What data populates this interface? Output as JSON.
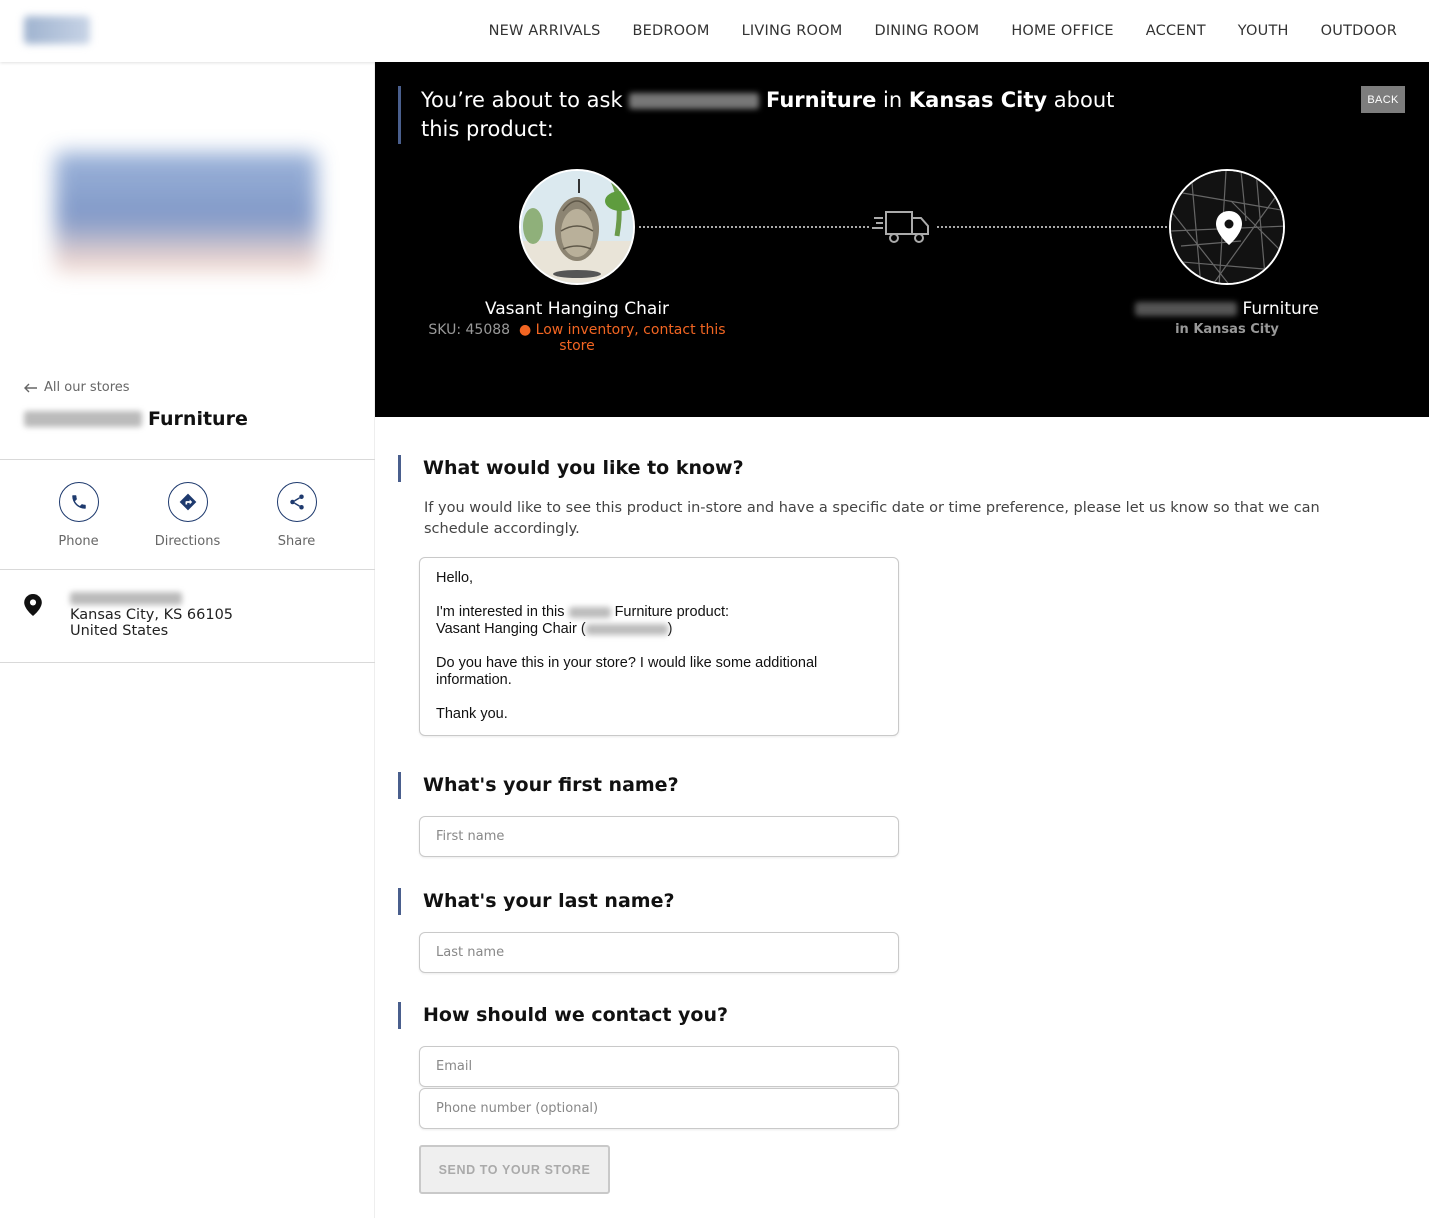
{
  "header": {
    "nav": [
      "NEW ARRIVALS",
      "BEDROOM",
      "LIVING ROOM",
      "DINING ROOM",
      "HOME OFFICE",
      "ACCENT",
      "YOUTH",
      "OUTDOOR"
    ]
  },
  "sidebar": {
    "back_label": "All our stores",
    "store_name": "Furniture",
    "actions": [
      "Phone",
      "Directions",
      "Share"
    ],
    "address": {
      "city_line": "Kansas City, KS 66105",
      "country": "United States"
    }
  },
  "hero": {
    "title_prefix": "You’re about to ask",
    "title_store": "Furniture",
    "title_in": "in",
    "title_city": "Kansas City",
    "title_suffix": "about this product:",
    "back_label": "BACK",
    "product_name": "Vasant Hanging Chair",
    "sku": "SKU: 45088",
    "inventory_warning": "● Low inventory, contact this store",
    "store_label": "Furniture",
    "store_sub": "in Kansas City"
  },
  "form": {
    "q1": "What would you like to know?",
    "hint": "If you would like to see this product in-store and have a specific date or time preference, please let us know so that we can schedule accordingly.",
    "message": {
      "greeting": "Hello,",
      "line1_a": "I'm interested in this",
      "line1_b": "Furniture product:",
      "product": "Vasant Hanging Chair (",
      "product_close": ")",
      "line2": "Do you have this in your store? I would like some additional information.",
      "closing": "Thank you."
    },
    "q2": "What's your first name?",
    "first_name_placeholder": "First name",
    "q3": "What's your last name?",
    "last_name_placeholder": "Last name",
    "q4": "How should we contact you?",
    "email_placeholder": "Email",
    "phone_placeholder": "Phone number (optional)",
    "submit_label": "SEND TO YOUR STORE"
  }
}
